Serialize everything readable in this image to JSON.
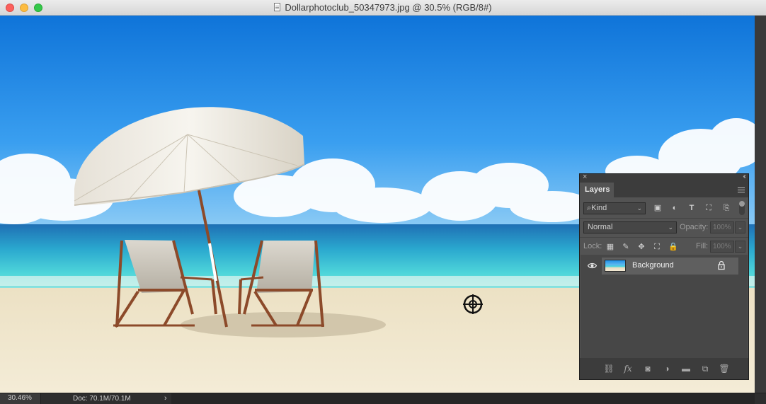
{
  "window": {
    "title": "Dollarphotoclub_50347973.jpg @ 30.5% (RGB/8#)"
  },
  "status_bar": {
    "zoom": "30.46%",
    "doc_info": "Doc: 70.1M/70.1M",
    "arrow": "›"
  },
  "layers_panel": {
    "tab_label": "Layers",
    "filter": {
      "kind_value": "Kind",
      "icons": [
        "image-filter-icon",
        "adjustment-filter-icon",
        "type-filter-icon",
        "shape-filter-icon",
        "smart-object-filter-icon"
      ]
    },
    "blend_mode": "Normal",
    "opacity_label": "Opacity:",
    "opacity_value": "100%",
    "lock_label": "Lock:",
    "fill_label": "Fill:",
    "fill_value": "100%",
    "layers": [
      {
        "name": "Background",
        "visible": true,
        "locked": true
      }
    ],
    "footer_icons": [
      "link-layers-icon",
      "fx-icon",
      "mask-icon",
      "adjustment-layer-icon",
      "group-folder-icon",
      "new-layer-icon",
      "trash-icon"
    ]
  },
  "colors": {
    "panel_bg": "#535353",
    "sky_top": "#0f74d9",
    "sea": "#2fc6d6",
    "sand": "#efe4c8"
  }
}
